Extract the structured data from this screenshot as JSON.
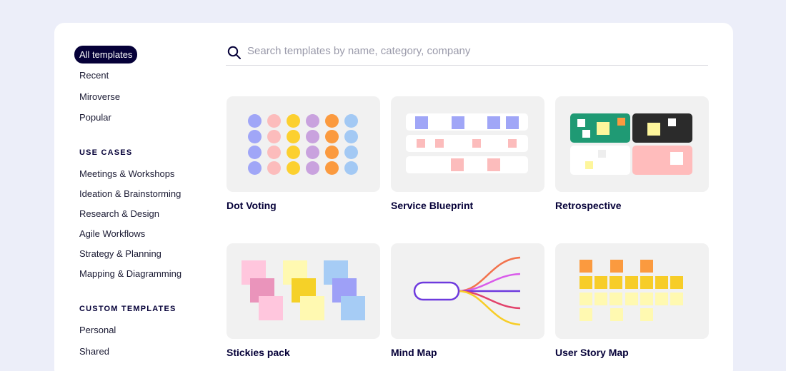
{
  "sidebar": {
    "active_item": "All templates",
    "items": [
      "Recent",
      "Miroverse",
      "Popular"
    ],
    "use_cases_title": "USE CASES",
    "use_cases": [
      "Meetings & Workshops",
      "Ideation & Brainstorming",
      "Research & Design",
      "Agile Workflows",
      "Strategy & Planning",
      "Mapping & Diagramming"
    ],
    "custom_title": "CUSTOM TEMPLATES",
    "custom": [
      "Personal",
      "Shared"
    ]
  },
  "search": {
    "placeholder": "Search templates by name, category, company",
    "icon": "search-icon"
  },
  "templates": [
    {
      "name": "Dot Voting"
    },
    {
      "name": "Service Blueprint"
    },
    {
      "name": "Retrospective"
    },
    {
      "name": "Stickies pack"
    },
    {
      "name": "Mind Map"
    },
    {
      "name": "User Story Map"
    }
  ],
  "colors": {
    "accent": "#050038",
    "background": "#eceef9",
    "card": "#f1f1f1",
    "dot_voting": [
      "#a0a6f7",
      "#fcbcbc",
      "#fcd02f",
      "#c9a2de",
      "#fb9a3f",
      "#a3c9f4"
    ],
    "retro_green": "#1f9a74",
    "retro_dark": "#2b2b2b",
    "retro_pink": "#ffbcbc",
    "mind_map_node": "#6e3ade"
  }
}
